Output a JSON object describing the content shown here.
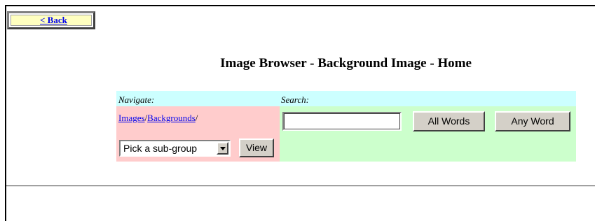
{
  "back": {
    "label": "< Back"
  },
  "title": "Image Browser - Background Image - Home",
  "navigate": {
    "heading": "Navigate:",
    "crumbs": [
      "Images",
      "Backgrounds"
    ],
    "separator": "/",
    "select_value": "Pick a sub-group",
    "view_label": "View"
  },
  "search": {
    "heading": "Search:",
    "input_value": "",
    "all_words_label": "All Words",
    "any_word_label": "Any Word"
  },
  "colors": {
    "header_bg": "#ccffff",
    "navigate_bg": "#ffcccc",
    "search_bg": "#ccffcc",
    "back_bg": "#ffffc0",
    "link": "#0000ee"
  }
}
